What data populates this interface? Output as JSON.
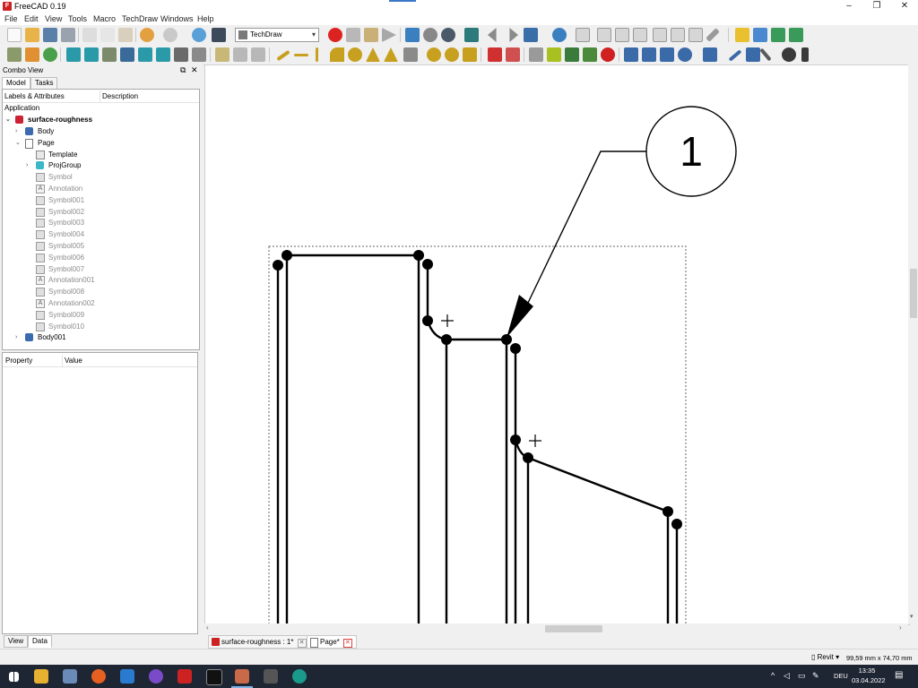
{
  "window": {
    "title": "FreeCAD 0.19"
  },
  "menu": [
    "File",
    "Edit",
    "View",
    "Tools",
    "Macro",
    "TechDraw",
    "Windows",
    "Help"
  ],
  "workbench": "TechDraw",
  "combo": {
    "title": "Combo View",
    "tabs": [
      "Model",
      "Tasks"
    ],
    "columns": [
      "Labels & Attributes",
      "Description"
    ],
    "root": "Application",
    "document": "surface-roughness",
    "items": [
      {
        "label": "Body",
        "level": 1,
        "expander": "›",
        "icon": "body"
      },
      {
        "label": "Page",
        "level": 1,
        "expander": "⌄",
        "icon": "page"
      },
      {
        "label": "Template",
        "level": 2,
        "expander": "",
        "icon": "template"
      },
      {
        "label": "ProjGroup",
        "level": 2,
        "expander": "›",
        "icon": "projgroup"
      },
      {
        "label": "Symbol",
        "level": 2,
        "expander": "",
        "icon": "symbol",
        "grey": true
      },
      {
        "label": "Annotation",
        "level": 2,
        "expander": "",
        "icon": "annotation",
        "grey": true
      },
      {
        "label": "Symbol001",
        "level": 2,
        "expander": "",
        "icon": "symbol",
        "grey": true
      },
      {
        "label": "Symbol002",
        "level": 2,
        "expander": "",
        "icon": "symbol",
        "grey": true
      },
      {
        "label": "Symbol003",
        "level": 2,
        "expander": "",
        "icon": "symbol",
        "grey": true
      },
      {
        "label": "Symbol004",
        "level": 2,
        "expander": "",
        "icon": "symbol",
        "grey": true
      },
      {
        "label": "Symbol005",
        "level": 2,
        "expander": "",
        "icon": "symbol",
        "grey": true
      },
      {
        "label": "Symbol006",
        "level": 2,
        "expander": "",
        "icon": "symbol",
        "grey": true
      },
      {
        "label": "Symbol007",
        "level": 2,
        "expander": "",
        "icon": "symbol",
        "grey": true
      },
      {
        "label": "Annotation001",
        "level": 2,
        "expander": "",
        "icon": "annotation",
        "grey": true
      },
      {
        "label": "Symbol008",
        "level": 2,
        "expander": "",
        "icon": "symbol",
        "grey": true
      },
      {
        "label": "Annotation002",
        "level": 2,
        "expander": "",
        "icon": "annotation",
        "grey": true
      },
      {
        "label": "Symbol009",
        "level": 2,
        "expander": "",
        "icon": "symbol",
        "grey": true
      },
      {
        "label": "Symbol010",
        "level": 2,
        "expander": "",
        "icon": "symbol",
        "grey": true
      },
      {
        "label": "Body001",
        "level": 1,
        "expander": "›",
        "icon": "body"
      }
    ],
    "property_columns": [
      "Property",
      "Value"
    ],
    "bottom_tabs": [
      "View",
      "Data"
    ]
  },
  "drawing": {
    "balloon_label": "1"
  },
  "doc_tabs": [
    {
      "label": "surface-roughness : 1*",
      "icon": "freecad"
    },
    {
      "label": "Page*",
      "icon": "page"
    }
  ],
  "status": {
    "nav_style": "Revit",
    "dimensions": "99,59 mm x 74,70 mm"
  },
  "taskbar": {
    "language": "DEU",
    "time": "13:35",
    "date": "03.04.2022"
  }
}
